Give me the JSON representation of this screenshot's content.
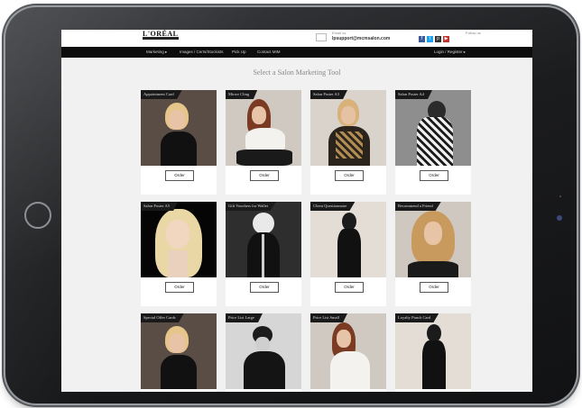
{
  "header": {
    "logo_text": "L'ORÉAL",
    "contact_label": "Email us",
    "contact_email": "lpsupport@mcmsalon.com",
    "follow_label": "Follow us"
  },
  "nav": {
    "marketing": "Marketing ▸",
    "images": "Images / Certs/Stockists",
    "pick_up": "Pick Up",
    "contact": "Contact MIM",
    "login": "Login / Register ▸"
  },
  "page_title": "Select a Salon Marketing Tool",
  "order_label": "Order",
  "cards": [
    {
      "title": "Appointment Card"
    },
    {
      "title": "Mirror Cling"
    },
    {
      "title": "Salon Poster A3"
    },
    {
      "title": "Salon Poster A4"
    },
    {
      "title": "Salon Poster A5"
    },
    {
      "title": "Gift Vouchers for Wallet"
    },
    {
      "title": "Client Questionnaire"
    },
    {
      "title": "Recommend a Friend"
    },
    {
      "title": "Special Offer Cards"
    },
    {
      "title": "Price List Large"
    },
    {
      "title": "Price List Small"
    },
    {
      "title": "Loyalty Punch Card"
    }
  ]
}
